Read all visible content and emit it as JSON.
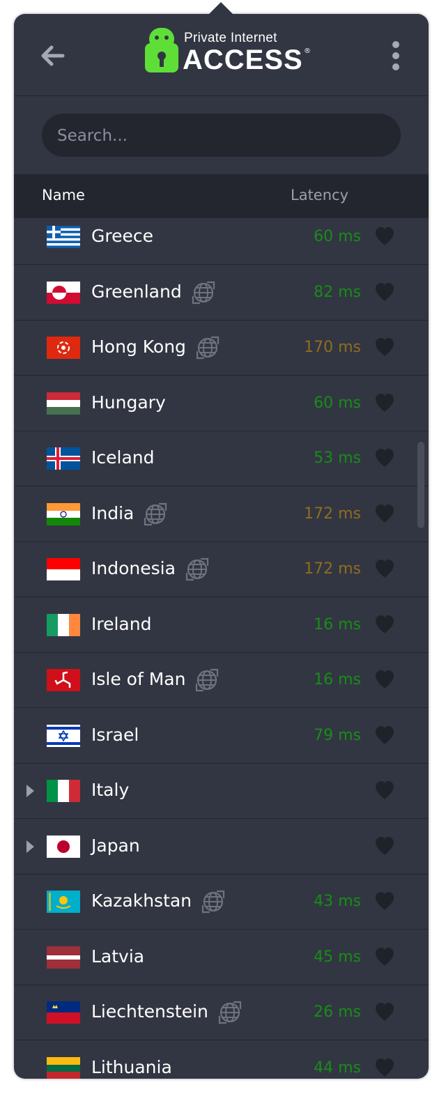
{
  "app": {
    "brand_small": "Private Internet",
    "brand_big": "ACCESS",
    "brand_mark": "®"
  },
  "icons": {
    "back": "arrow-left-icon",
    "menu": "kebab-menu-icon",
    "geo": "geo-globe-icon",
    "favorite": "heart-icon",
    "expand": "triangle-right-icon"
  },
  "colors": {
    "background": "#323642",
    "header_bar": "#23262e",
    "latency_good": "#178d17",
    "latency_medium": "#8f6d1e",
    "heart": "#1f2229",
    "brand_green": "#5ddf38"
  },
  "search": {
    "placeholder": "Search..."
  },
  "columns": {
    "name": "Name",
    "latency": "Latency"
  },
  "regions": [
    {
      "name": "Greece",
      "flag": "greece",
      "geo": false,
      "latency": "60 ms",
      "level": "good",
      "expandable": false
    },
    {
      "name": "Greenland",
      "flag": "greenland",
      "geo": true,
      "latency": "82 ms",
      "level": "good",
      "expandable": false
    },
    {
      "name": "Hong Kong",
      "flag": "hongkong",
      "geo": true,
      "latency": "170 ms",
      "level": "medium",
      "expandable": false
    },
    {
      "name": "Hungary",
      "flag": "hungary",
      "geo": false,
      "latency": "60 ms",
      "level": "good",
      "expandable": false
    },
    {
      "name": "Iceland",
      "flag": "iceland",
      "geo": false,
      "latency": "53 ms",
      "level": "good",
      "expandable": false
    },
    {
      "name": "India",
      "flag": "india",
      "geo": true,
      "latency": "172 ms",
      "level": "medium",
      "expandable": false
    },
    {
      "name": "Indonesia",
      "flag": "indonesia",
      "geo": true,
      "latency": "172 ms",
      "level": "medium",
      "expandable": false
    },
    {
      "name": "Ireland",
      "flag": "ireland",
      "geo": false,
      "latency": "16 ms",
      "level": "good",
      "expandable": false
    },
    {
      "name": "Isle of Man",
      "flag": "isleofman",
      "geo": true,
      "latency": "16 ms",
      "level": "good",
      "expandable": false
    },
    {
      "name": "Israel",
      "flag": "israel",
      "geo": false,
      "latency": "79 ms",
      "level": "good",
      "expandable": false
    },
    {
      "name": "Italy",
      "flag": "italy",
      "geo": false,
      "latency": "",
      "level": "good",
      "expandable": true
    },
    {
      "name": "Japan",
      "flag": "japan",
      "geo": false,
      "latency": "",
      "level": "good",
      "expandable": true
    },
    {
      "name": "Kazakhstan",
      "flag": "kazakhstan",
      "geo": true,
      "latency": "43 ms",
      "level": "good",
      "expandable": false
    },
    {
      "name": "Latvia",
      "flag": "latvia",
      "geo": false,
      "latency": "45 ms",
      "level": "good",
      "expandable": false
    },
    {
      "name": "Liechtenstein",
      "flag": "liechtenstein",
      "geo": true,
      "latency": "26 ms",
      "level": "good",
      "expandable": false
    },
    {
      "name": "Lithuania",
      "flag": "lithuania",
      "geo": false,
      "latency": "44 ms",
      "level": "good",
      "expandable": false
    }
  ]
}
